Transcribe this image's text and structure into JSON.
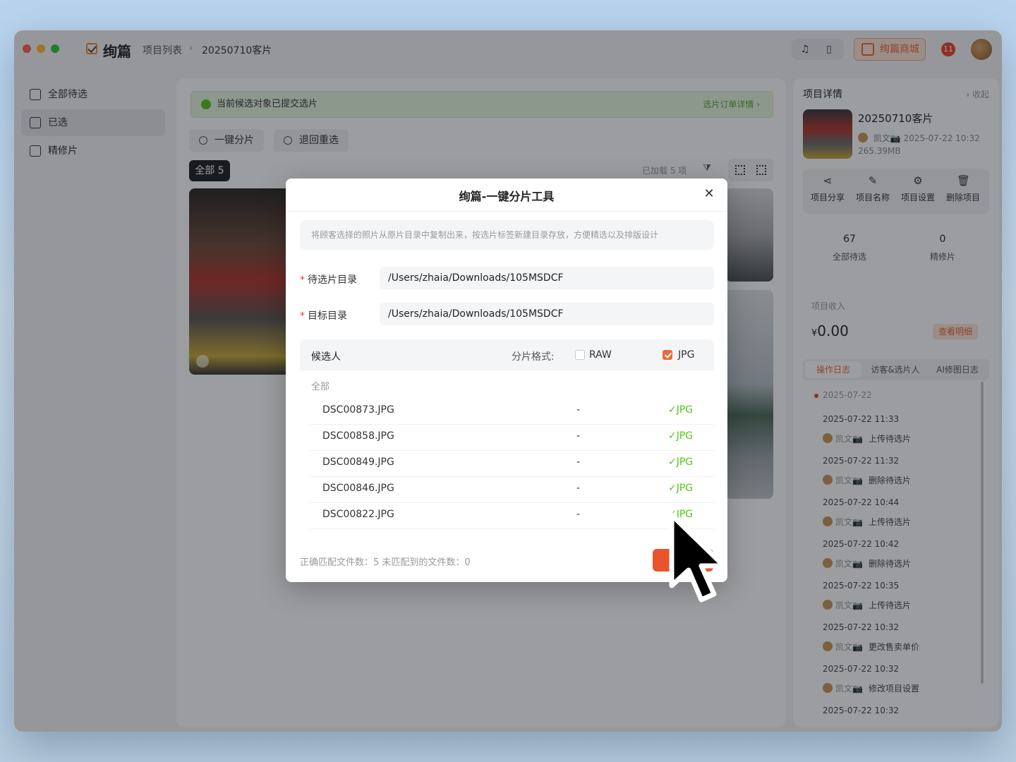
{
  "window": {
    "app_title": "绚篇",
    "breadcrumb": [
      "项目列表",
      "20250710客片"
    ],
    "breadcrumb_sep": "›",
    "shop_button": "绚篇商城",
    "notification_count": "11"
  },
  "sidebar": {
    "items": [
      {
        "label": "全部待选"
      },
      {
        "label": "已选"
      },
      {
        "label": "精修片"
      }
    ],
    "active_index": 1
  },
  "main": {
    "banner_text": "当前候选对象已提交选片",
    "banner_link": "选片订单详情 ›",
    "actions": [
      "一键分片",
      "退回重选"
    ],
    "tab_all_label": "全部",
    "tab_all_count": "5",
    "loaded_text": "已加载 5 项"
  },
  "right_panel": {
    "title": "项目详情",
    "collapse": "› 收起",
    "project_name": "20250710客片",
    "owner": "凯文📷",
    "created": "2025-07-22 10:32",
    "size": "265.39MB",
    "actions": [
      "项目分享",
      "项目名称",
      "项目设置",
      "删除项目"
    ],
    "stats": [
      {
        "value": "67",
        "label": "全部待选"
      },
      {
        "value": "0",
        "label": "精修片"
      }
    ],
    "income_label": "项目收入",
    "income_currency": "¥",
    "income_value": "0.00",
    "detail_button": "查看明细",
    "tabs": [
      "操作日志",
      "访客&选片人",
      "AI修图日志"
    ],
    "log_date": "2025-07-22",
    "logs": [
      {
        "time": "2025-07-22 11:33",
        "user": "凯文📷",
        "action": "上传待选片"
      },
      {
        "time": "2025-07-22 11:32",
        "user": "凯文📷",
        "action": "删除待选片"
      },
      {
        "time": "2025-07-22 10:44",
        "user": "凯文📷",
        "action": "上传待选片"
      },
      {
        "time": "2025-07-22 10:42",
        "user": "凯文📷",
        "action": "删除待选片"
      },
      {
        "time": "2025-07-22 10:35",
        "user": "凯文📷",
        "action": "上传待选片"
      },
      {
        "time": "2025-07-22 10:32",
        "user": "凯文📷",
        "action": "更改售卖单价"
      },
      {
        "time": "2025-07-22 10:32",
        "user": "凯文📷",
        "action": "修改项目设置"
      },
      {
        "time": "2025-07-22 10:32",
        "user": "",
        "action": ""
      }
    ]
  },
  "modal": {
    "title": "绚篇-一键分片工具",
    "close": "✕",
    "description": "将顾客选择的照片从原片目录中复制出来，按选片标签新建目录存放，方便精选以及排版设计",
    "source_label": "待选片目录",
    "source_value": "/Users/zhaia/Downloads/105MSDCF",
    "target_label": "目标目录",
    "target_value": "/Users/zhaia/Downloads/105MSDCF",
    "table_header": "候选人",
    "format_label": "分片格式:",
    "formats": [
      {
        "label": "RAW",
        "checked": false
      },
      {
        "label": "JPG",
        "checked": true
      }
    ],
    "group_label": "全部",
    "files": [
      {
        "name": "DSC00873.JPG",
        "raw": "-",
        "jpg": "✓JPG"
      },
      {
        "name": "DSC00858.JPG",
        "raw": "-",
        "jpg": "✓JPG"
      },
      {
        "name": "DSC00849.JPG",
        "raw": "-",
        "jpg": "✓JPG"
      },
      {
        "name": "DSC00846.JPG",
        "raw": "-",
        "jpg": "✓JPG"
      },
      {
        "name": "DSC00822.JPG",
        "raw": "-",
        "jpg": "✓JPG"
      }
    ],
    "footer": "正确匹配文件数：5 未匹配到的文件数：0",
    "confirm": "确定"
  },
  "colors": {
    "accent": "#e86b3a",
    "success": "#52c41a",
    "danger": "#e9422c"
  }
}
